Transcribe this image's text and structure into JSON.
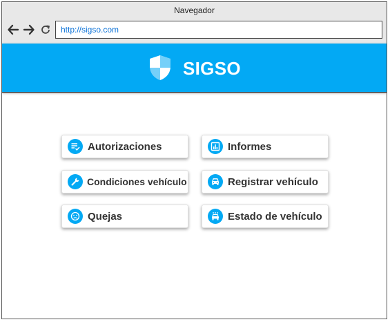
{
  "window": {
    "title": "Navegador"
  },
  "browser": {
    "url": "http://sigso.com"
  },
  "header": {
    "brand": "SIGSO",
    "color": "#03a9f4"
  },
  "menu": {
    "autorizaciones": {
      "label": "Autorizaciones",
      "icon": "checklist-icon"
    },
    "informes": {
      "label": "Informes",
      "icon": "bar-chart-icon"
    },
    "condiciones": {
      "label": "Condiciones vehículo",
      "icon": "wrench-icon"
    },
    "registrar": {
      "label": "Registrar vehículo",
      "icon": "car-icon"
    },
    "quejas": {
      "label": "Quejas",
      "icon": "sad-face-icon"
    },
    "estado": {
      "label": "Estado de vehículo",
      "icon": "car-wash-icon"
    }
  }
}
